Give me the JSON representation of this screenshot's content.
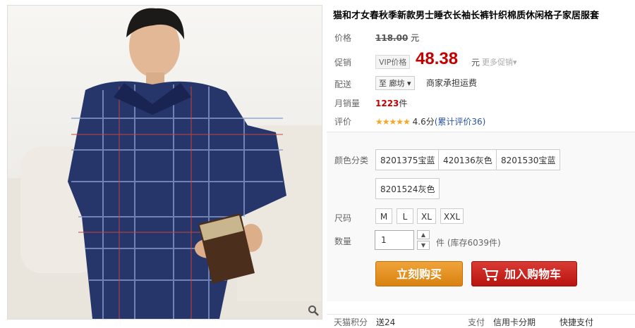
{
  "product": {
    "title": "猫和才女春秋季新款男士睡衣长袖长裤针织棉质休闲格子家居服套"
  },
  "price": {
    "label": "价格",
    "original": "118.00",
    "currency": "元"
  },
  "promo": {
    "label": "促销",
    "vip_tag": "VIP价格",
    "price": "48.38",
    "currency": "元",
    "more": "更多促销▾"
  },
  "shipping": {
    "label": "配送",
    "destination": "至 廊坊 ▾",
    "note": "商家承担运费"
  },
  "monthly_sales": {
    "label": "月销量",
    "value": "1223",
    "unit": "件"
  },
  "rating": {
    "label": "评价",
    "stars": "★★★★★",
    "score": "4.6分",
    "count_text": "(累计评价36)"
  },
  "options": {
    "color_label": "颜色分类",
    "colors": [
      "8201375宝蓝",
      "420136灰色",
      "8201530宝蓝",
      "8201524灰色"
    ],
    "size_label": "尺码",
    "sizes": [
      "M",
      "L",
      "XL",
      "XXL"
    ],
    "qty_label": "数量",
    "qty_value": "1",
    "stock_text": "件 (库存6039件)"
  },
  "actions": {
    "buy_now": "立刻购买",
    "add_to_cart": "加入购物车"
  },
  "footer": {
    "points_label": "天猫积分",
    "points_value": "送24",
    "pay_label": "支付",
    "credit": "信用卡分期",
    "express": "快捷支付"
  },
  "colors": {
    "price_red": "#c40000",
    "buy_orange": "#e08e1a",
    "cart_red": "#c6211b"
  }
}
